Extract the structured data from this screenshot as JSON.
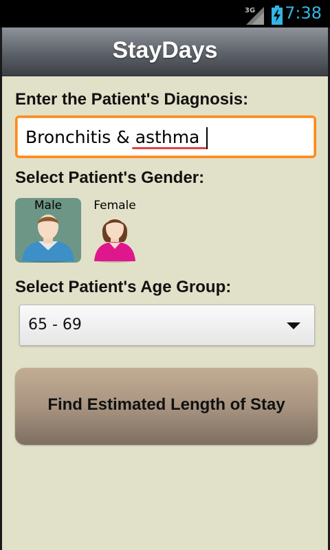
{
  "status_bar": {
    "network": "3G",
    "time": "7:38",
    "clock_color": "#33b5e5"
  },
  "app": {
    "title": "StayDays"
  },
  "diagnosis": {
    "label": "Enter the Patient's Diagnosis:",
    "value": "Bronchitis & asthma"
  },
  "gender": {
    "label": "Select Patient's Gender:",
    "options": [
      {
        "label": "Male",
        "selected": true
      },
      {
        "label": "Female",
        "selected": false
      }
    ]
  },
  "age_group": {
    "label": "Select Patient's Age Group:",
    "selected": "65 - 69"
  },
  "action": {
    "label": "Find Estimated Length of Stay"
  },
  "colors": {
    "background": "#e1e0c8",
    "input_focus_border": "#ff8a1a",
    "selected_gender": "#6e9687",
    "button": "#a89480"
  }
}
